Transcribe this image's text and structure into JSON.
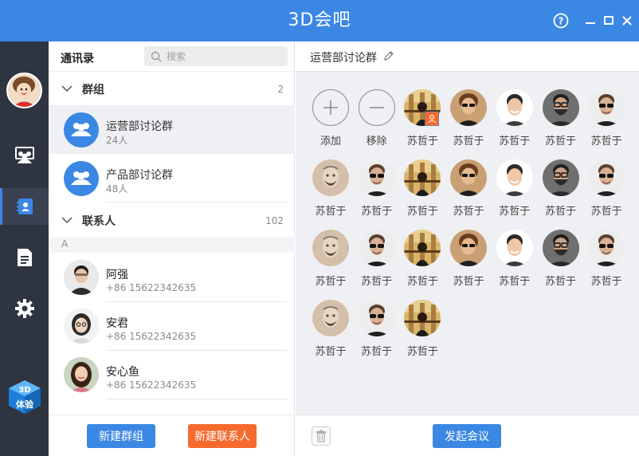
{
  "app": {
    "title": "3D会吧"
  },
  "window_controls": {
    "help": "?",
    "minimize": "minimize",
    "maximize": "maximize",
    "close": "close"
  },
  "nav": {
    "items": [
      {
        "name": "meetings",
        "icon": "meeting-icon"
      },
      {
        "name": "contacts",
        "icon": "contacts-icon",
        "active": true
      },
      {
        "name": "documents",
        "icon": "document-icon"
      },
      {
        "name": "settings",
        "icon": "gear-icon"
      }
    ],
    "logo_text": "3D体验"
  },
  "contacts": {
    "title": "通讯录",
    "search_placeholder": "搜索",
    "groups_section": {
      "title": "群组",
      "count": "2"
    },
    "groups": [
      {
        "name": "运营部讨论群",
        "count": "24人",
        "selected": true
      },
      {
        "name": "产品部讨论群",
        "count": "48人"
      }
    ],
    "people_section": {
      "title": "联系人",
      "count": "102"
    },
    "index_letter": "A",
    "people": [
      {
        "name": "阿强",
        "phone": "+86 15622342635"
      },
      {
        "name": "安君",
        "phone": "+86 15622342635"
      },
      {
        "name": "安心鱼",
        "phone": "+86 15622342635"
      }
    ],
    "new_group_label": "新建群组",
    "new_contact_label": "新建联系人"
  },
  "detail": {
    "title": "运营部讨论群",
    "add_label": "添加",
    "remove_label": "移除",
    "members": [
      {
        "name": "苏哲于",
        "avatar": "city",
        "admin": true
      },
      {
        "name": "苏哲于",
        "avatar": "shades"
      },
      {
        "name": "苏哲于",
        "avatar": "smile"
      },
      {
        "name": "苏哲于",
        "avatar": "beard"
      },
      {
        "name": "苏哲于",
        "avatar": "sunglasses"
      },
      {
        "name": "苏哲于",
        "avatar": "sketch"
      },
      {
        "name": "苏哲于",
        "avatar": "sunglasses"
      },
      {
        "name": "苏哲于",
        "avatar": "city"
      },
      {
        "name": "苏哲于",
        "avatar": "shades"
      },
      {
        "name": "苏哲于",
        "avatar": "smile"
      },
      {
        "name": "苏哲于",
        "avatar": "beard"
      },
      {
        "name": "苏哲于",
        "avatar": "sunglasses"
      },
      {
        "name": "苏哲于",
        "avatar": "sketch"
      },
      {
        "name": "苏哲于",
        "avatar": "sunglasses"
      },
      {
        "name": "苏哲于",
        "avatar": "city"
      },
      {
        "name": "苏哲于",
        "avatar": "shades"
      },
      {
        "name": "苏哲于",
        "avatar": "smile"
      },
      {
        "name": "苏哲于",
        "avatar": "beard"
      },
      {
        "name": "苏哲于",
        "avatar": "sunglasses"
      },
      {
        "name": "苏哲于",
        "avatar": "sketch"
      },
      {
        "name": "苏哲于",
        "avatar": "sunglasses"
      },
      {
        "name": "苏哲于",
        "avatar": "city"
      }
    ],
    "start_meeting_label": "发起会议"
  },
  "colors": {
    "primary": "#3b87e4",
    "accent": "#f66a2d",
    "nav_bg": "#2e3440"
  }
}
